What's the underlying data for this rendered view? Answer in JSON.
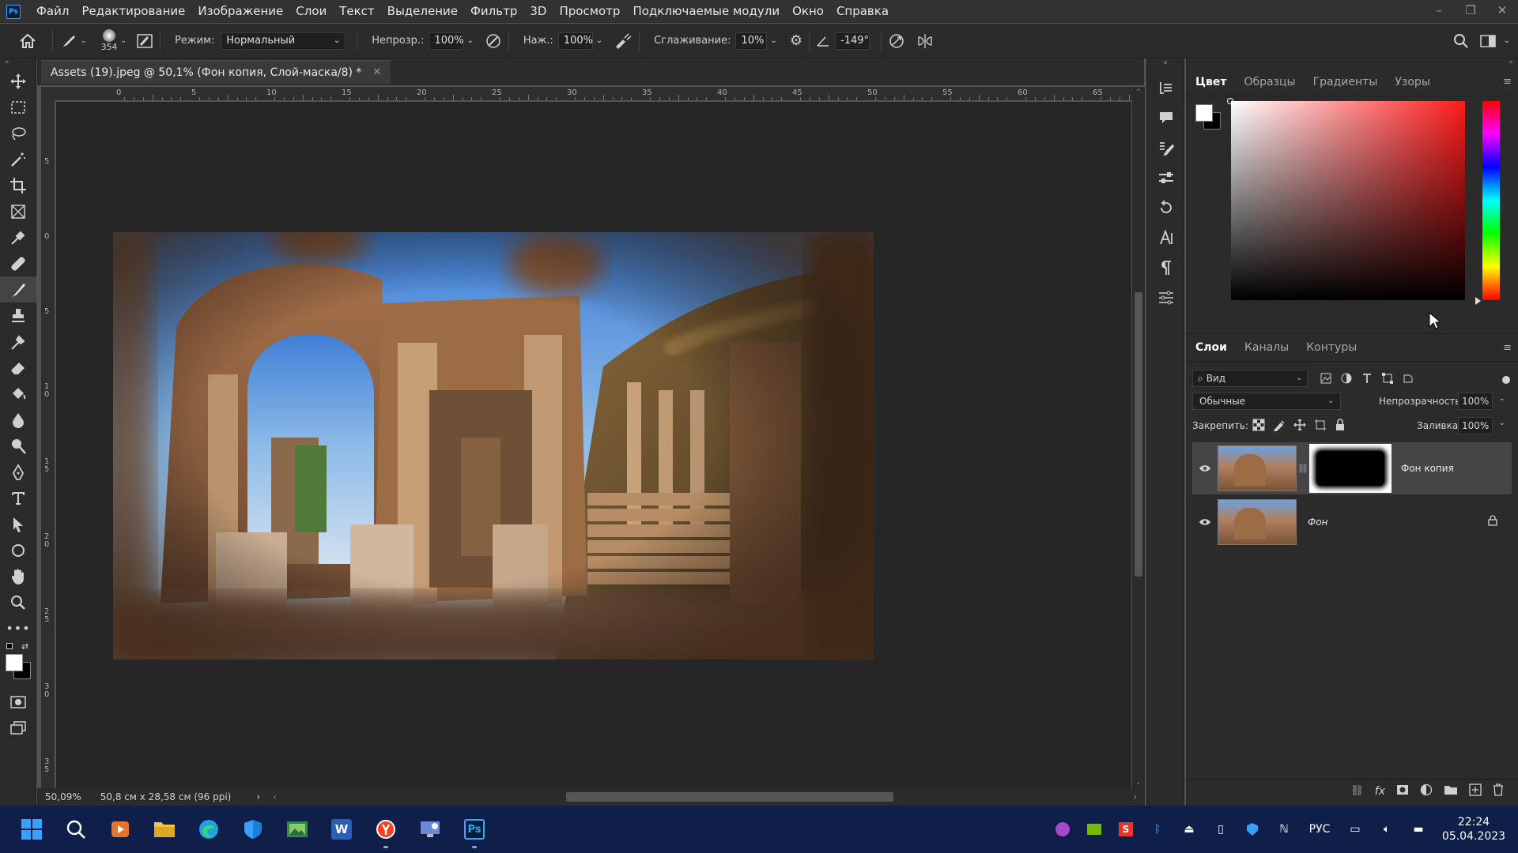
{
  "menubar": {
    "logo": "Ps",
    "items": [
      "Файл",
      "Редактирование",
      "Изображение",
      "Слои",
      "Текст",
      "Выделение",
      "Фильтр",
      "3D",
      "Просмотр",
      "Подключаемые модули",
      "Окно",
      "Справка"
    ],
    "minimize": "–",
    "restore": "❐",
    "close": "✕"
  },
  "options": {
    "brush_size": "354",
    "mode_label": "Режим:",
    "mode_value": "Нормальный",
    "opacity_label": "Непрозр.:",
    "opacity_value": "100%",
    "pressure_label": "Наж.:",
    "pressure_value": "100%",
    "smoothing_label": "Сглаживание:",
    "smoothing_value": "10%",
    "angle_value": "-149°"
  },
  "document": {
    "tab_title": "Assets (19).jpeg @ 50,1% (Фон копия, Слой-маска/8) *",
    "close": "✕",
    "ruler_top": [
      "0",
      "5",
      "10",
      "15",
      "20",
      "25",
      "30",
      "35",
      "40",
      "45",
      "50",
      "55",
      "60",
      "65"
    ],
    "ruler_left": [
      "5",
      "0",
      "5",
      "1\n0",
      "1\n5",
      "2\n0",
      "2\n5",
      "3\n0",
      "3\n5"
    ],
    "zoom": "50,09%",
    "size_info": "50,8 см x 28,58 см (96 ppi)",
    "status_arrow": "›"
  },
  "color_panel": {
    "tabs": [
      "Цвет",
      "Образцы",
      "Градиенты",
      "Узоры"
    ],
    "hue_color": "#ff1a1a"
  },
  "layers_panel": {
    "tabs": [
      "Слои",
      "Каналы",
      "Контуры"
    ],
    "filter_placeholder": "Вид",
    "blend_mode": "Обычные",
    "opacity_label": "Непрозрачность:",
    "opacity_value": "100%",
    "lock_label": "Закрепить:",
    "fill_label": "Заливка:",
    "fill_value": "100%",
    "layers": [
      {
        "name": "Фон копия",
        "selected": true
      },
      {
        "name": "Фон",
        "selected": false
      }
    ]
  },
  "taskbar": {
    "lang": "РУС",
    "time": "22:24",
    "date": "05.04.2023",
    "ps_label": "Ps",
    "word_label": "W"
  }
}
